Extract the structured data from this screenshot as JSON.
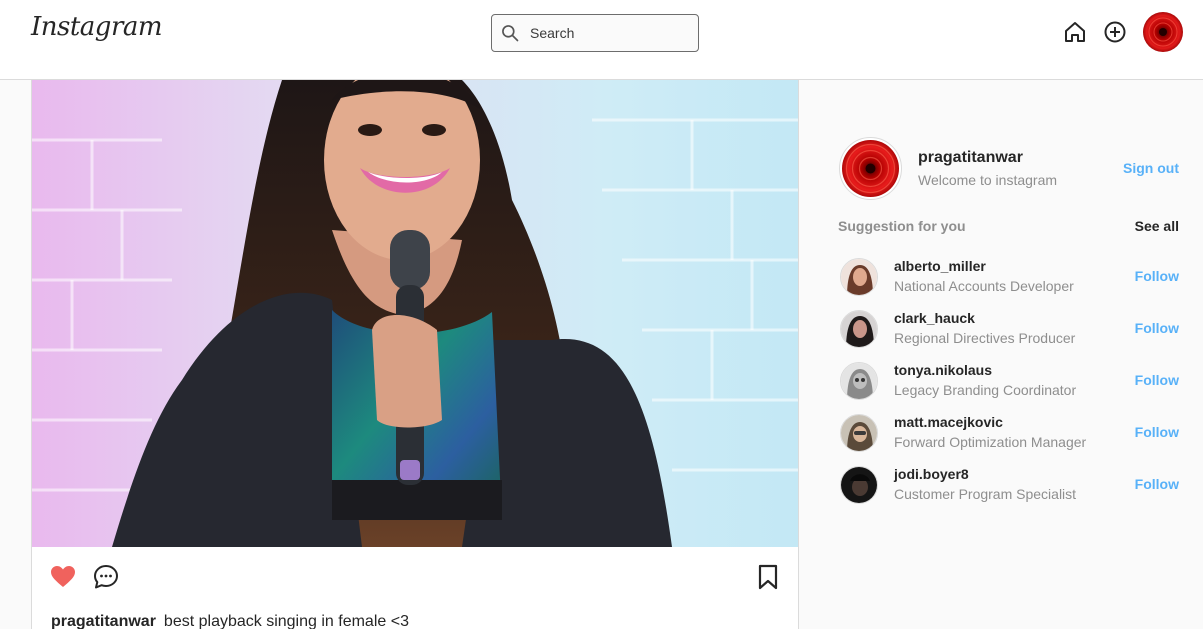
{
  "header": {
    "logo": "Instagram",
    "search": {
      "placeholder": "Search",
      "value": ""
    }
  },
  "post": {
    "liked": true,
    "caption_user": "pragatitanwar",
    "caption_text": "best playback singing in female <3"
  },
  "profile": {
    "username": "pragatitanwar",
    "subtitle": "Welcome to instagram",
    "sign_out": "Sign out"
  },
  "suggestions": {
    "title": "Suggestion for you",
    "see_all": "See all",
    "items": [
      {
        "username": "alberto_miller",
        "job": "National Accounts Developer",
        "follow": "Follow"
      },
      {
        "username": "clark_hauck",
        "job": "Regional Directives Producer",
        "follow": "Follow"
      },
      {
        "username": "tonya.nikolaus",
        "job": "Legacy Branding Coordinator",
        "follow": "Follow"
      },
      {
        "username": "matt.macejkovic",
        "job": "Forward Optimization Manager",
        "follow": "Follow"
      },
      {
        "username": "jodi.boyer8",
        "job": "Customer Program Specialist",
        "follow": "Follow"
      }
    ]
  },
  "colors": {
    "like": "#f0625d",
    "link_blue": "#58b1f8",
    "muted": "#8e8e8e",
    "text": "#262626"
  }
}
